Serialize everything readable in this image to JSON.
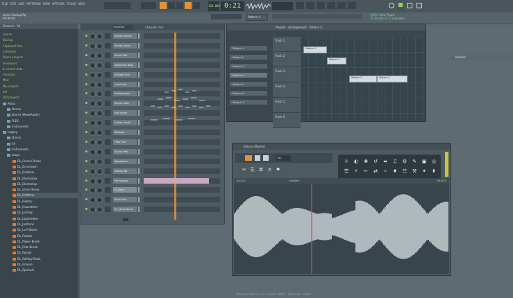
{
  "menu": [
    "FILE",
    "EDIT",
    "ADD",
    "PATTERNS",
    "VIEW",
    "OPTIONS",
    "TOOLS",
    "HELP"
  ],
  "toolbar": {
    "time": "0:21",
    "time_sub": "M:S:CS",
    "bpm": "130.000",
    "pattern": "Pattern 4"
  },
  "hint": {
    "line1": "Lorne hookup.flp",
    "line2": "00:00:00"
  },
  "news": {
    "line1": "01/11 New Plugin",
    "line2": "FL Studio 21.1 available"
  },
  "browser": {
    "title": "Browser - All",
    "items": [
      {
        "label": "Scores",
        "type": "file"
      },
      {
        "label": "Backup",
        "type": "file"
      },
      {
        "label": "Clipboard files",
        "type": "file"
      },
      {
        "label": "Collected",
        "type": "file"
      },
      {
        "label": "Demo projects",
        "type": "file"
      },
      {
        "label": "Envelopes",
        "type": "file"
      },
      {
        "label": "IL shared data",
        "type": "file"
      },
      {
        "label": "Impulses",
        "type": "file"
      },
      {
        "label": "Misc",
        "type": "file"
      },
      {
        "label": "My projects",
        "type": "file"
      },
      {
        "label": "old",
        "type": "file"
      },
      {
        "label": "Old projects",
        "type": "file"
      },
      {
        "label": "Packs",
        "type": "folder"
      },
      {
        "label": "Drums",
        "type": "folder"
      },
      {
        "label": "Drums (ModeAudio)",
        "type": "folder"
      },
      {
        "label": "FLEX",
        "type": "folder"
      },
      {
        "label": "Instruments",
        "type": "folder"
      },
      {
        "label": "Legacy",
        "type": "folder"
      },
      {
        "label": "Drums",
        "type": "folder"
      },
      {
        "label": "FX",
        "type": "folder"
      },
      {
        "label": "Instruments",
        "type": "folder"
      },
      {
        "label": "Loops",
        "type": "folder"
      },
      {
        "label": "DL_Classic Break",
        "type": "loop"
      },
      {
        "label": "DL_Drumroom",
        "type": "loop"
      },
      {
        "label": "DL_Dubfunk",
        "type": "loop"
      },
      {
        "label": "DL_Electrobox",
        "type": "loop"
      },
      {
        "label": "DL_Electrohop",
        "type": "loop"
      },
      {
        "label": "DL_Ghost Break",
        "type": "loop"
      },
      {
        "label": "DL_Halftime",
        "type": "loop"
      },
      {
        "label": "DL_Hiphop",
        "type": "loop"
      },
      {
        "label": "DL_Housetime",
        "type": "loop"
      },
      {
        "label": "DL_Jazzhop",
        "type": "loop"
      },
      {
        "label": "DL_Jazzbreaker",
        "type": "loop"
      },
      {
        "label": "DL_Jazzfunk",
        "type": "loop"
      },
      {
        "label": "DL_Lo-fi Beats",
        "type": "loop"
      },
      {
        "label": "DL_Powder",
        "type": "loop"
      },
      {
        "label": "DL_Power Break",
        "type": "loop"
      },
      {
        "label": "DL_Ride Break",
        "type": "loop"
      },
      {
        "label": "DL_Rocker",
        "type": "loop"
      },
      {
        "label": "DL_Rolling Break",
        "type": "loop"
      },
      {
        "label": "DL_Groove",
        "type": "loop"
      },
      {
        "label": "DL_Spiritual",
        "type": "loop"
      }
    ]
  },
  "rack": {
    "title": "Channel rack",
    "filter": "Unsorted",
    "channels": [
      "Sound sprinkl",
      "Sound Lazer",
      "Snare 909",
      "Astronaut Dog",
      "Vintage Kick",
      "Lead saw",
      "Analog bass",
      "Sound bass",
      "Add chord",
      "Guitar chord",
      "Whisper",
      "Filter Vox",
      "Sound Pad",
      "Woodwind",
      "Mellow Bit",
      "Percussion",
      "FL Keys",
      "Slicer Vox",
      "DL_Housetime"
    ]
  },
  "playlist": {
    "title": "Playlist - Arrangement - Pattern 4",
    "patterns": [
      "Pattern 1",
      "Pattern 2",
      "Pattern 3",
      "Pattern 4",
      "Pattern 5",
      "Pattern 6",
      "Pattern 7"
    ],
    "tracks": [
      "Track 1",
      "Track 2",
      "Track 3",
      "Track 4",
      "Track 5",
      "Track 6"
    ],
    "clips": [
      "Pattern 1",
      "Pattern 2",
      "Pattern 3",
      "Pattern 5"
    ]
  },
  "edison": {
    "title": "Edison (Master)",
    "loop_label": "Halftime",
    "format_label": "441",
    "time_left": "00:00.1",
    "time_right": "00:00.0"
  },
  "monitor": {
    "label": "Monitor"
  },
  "status": "Producer Edition v21.1 [build 3865] - Windows - 64Bit"
}
